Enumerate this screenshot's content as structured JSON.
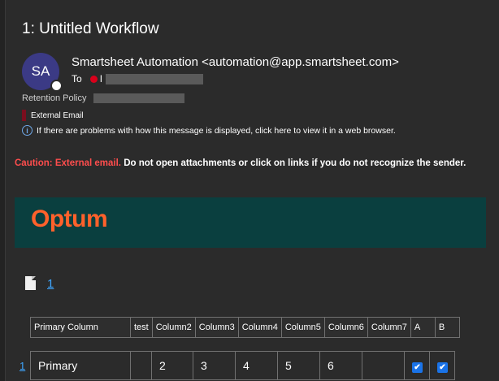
{
  "message": {
    "subject": "1: Untitled Workflow",
    "sender_initials": "SA",
    "sender": "Smartsheet Automation <automation@app.smartsheet.com>",
    "to_label": "To",
    "to_first_char": "I",
    "retention_label": "Retention Policy",
    "external_tag": "External Email",
    "info_text": "If there are problems with how this message is displayed, click here to view it in a web browser."
  },
  "body": {
    "caution_prefix": "Caution: External email.",
    "caution_text": " Do not open attachments or click on links if you do not recognize the sender.",
    "brand": "Optum",
    "sheet_link": "1"
  },
  "table": {
    "headers": [
      "Primary Column",
      "test",
      "Column2",
      "Column3",
      "Column4",
      "Column5",
      "Column6",
      "Column7",
      "A",
      "B"
    ],
    "row_number": "1",
    "row": [
      "Primary",
      "",
      "2",
      "3",
      "4",
      "5",
      "6",
      "",
      "✔",
      "✔"
    ]
  },
  "colors": {
    "background": "#2b2b2b",
    "banner": "#0a3f3f",
    "brand_orange": "#ff612b",
    "caution_red": "#ff4d4d",
    "link_blue": "#3ea6ff",
    "checkbox_blue": "#1a73e8"
  }
}
